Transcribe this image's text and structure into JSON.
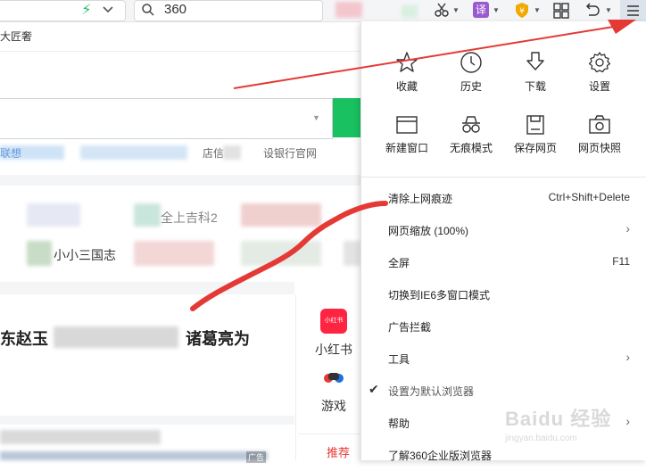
{
  "toolbar": {
    "search_value": "360",
    "translate_label": "译"
  },
  "favorites_bar": {
    "visible_text": "大匠奢"
  },
  "page": {
    "links_row": [
      "联想",
      "店信",
      "设银行官网"
    ],
    "grid_items": [
      "全上吉科2",
      "小小三国志"
    ],
    "news_left": "东赵玉",
    "news_right": "诸葛亮为",
    "side_apps": [
      "小红书",
      "游戏"
    ],
    "recommend_tab": "推荐",
    "ad_tag": "广告",
    "xhs_badge": "小红书"
  },
  "menu": {
    "grid_row1": [
      "收藏",
      "历史",
      "下载",
      "设置"
    ],
    "grid_row2": [
      "新建窗口",
      "无痕模式",
      "保存网页",
      "网页快照"
    ],
    "items": [
      {
        "label": "清除上网痕迹",
        "shortcut": "Ctrl+Shift+Delete"
      },
      {
        "label": "网页缩放 (100%)"
      },
      {
        "label": "全屏",
        "shortcut": "F11"
      },
      {
        "label": "切换到IE6多窗口模式"
      },
      {
        "label": "广告拦截"
      },
      {
        "label": "工具"
      },
      {
        "label": "设置为默认浏览器"
      },
      {
        "label": "帮助"
      },
      {
        "label": "了解360企业版浏览器"
      }
    ]
  },
  "watermark": {
    "logo_text": "Baidu 经验",
    "url_text": "jingyan.baidu.com"
  },
  "colors": {
    "annotation_red": "#e53935",
    "green_button": "#19c160",
    "translate_purple": "#9b59d0",
    "shield_gold": "#f2a900"
  },
  "icons": [
    "lightning-icon",
    "chevron-down-icon",
    "search-icon",
    "scissors-icon",
    "translate-icon",
    "shield-icon",
    "grid-icon",
    "undo-icon",
    "hamburger-icon",
    "star-icon",
    "clock-icon",
    "download-icon",
    "gear-icon",
    "window-icon",
    "incognito-icon",
    "save-icon",
    "camera-icon",
    "chevron-right-icon",
    "check-icon"
  ]
}
